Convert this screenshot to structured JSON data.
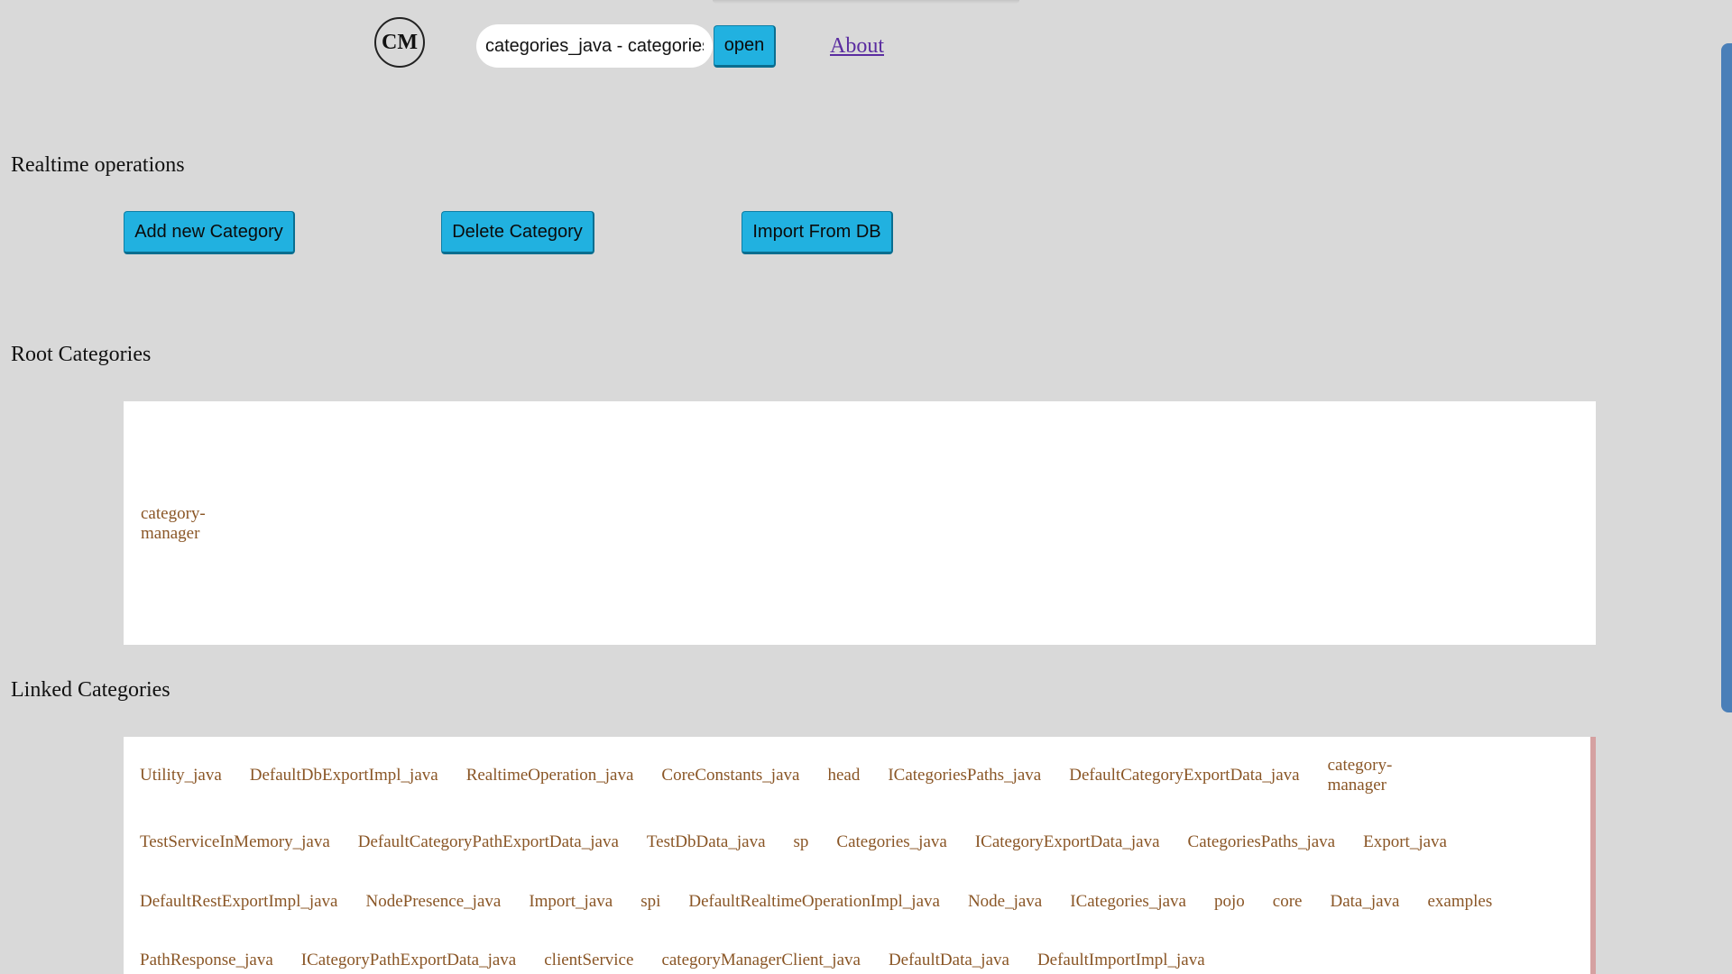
{
  "header": {
    "logo_text": "CM",
    "search_value": "categories_java - categories",
    "open_label": "open",
    "about_label": "About"
  },
  "realtime": {
    "title": "Realtime operations",
    "buttons": [
      "Add new Category",
      "Delete Category",
      "Import From DB"
    ]
  },
  "root": {
    "title": "Root Categories",
    "items": [
      "category-manager"
    ]
  },
  "linked": {
    "title": "Linked Categories",
    "rows": [
      [
        "Utility_java",
        "DefaultDbExportImpl_java",
        "RealtimeOperation_java",
        "CoreConstants_java",
        "head",
        "ICategoriesPaths_java",
        "DefaultCategoryExportData_java",
        "category-manager"
      ],
      [
        "TestServiceInMemory_java",
        "DefaultCategoryPathExportData_java",
        "TestDbData_java",
        "sp",
        "Categories_java",
        "ICategoryExportData_java",
        "CategoriesPaths_java",
        "Export_java"
      ],
      [
        "DefaultRestExportImpl_java",
        "NodePresence_java",
        "Import_java",
        "spi",
        "DefaultRealtimeOperationImpl_java",
        "Node_java",
        "ICategories_java",
        "pojo",
        "core",
        "Data_java",
        "examples"
      ],
      [
        "PathResponse_java",
        "ICategoryPathExportData_java",
        "clientService",
        "categoryManagerClient_java",
        "DefaultData_java",
        "DefaultImportImpl_java"
      ]
    ]
  },
  "colors": {
    "background": "#d9d9d9",
    "button": "#21b1e0",
    "category_text": "#8a5626",
    "link": "#5a2ca0",
    "scroll_thumb": "#4a7fb8"
  }
}
